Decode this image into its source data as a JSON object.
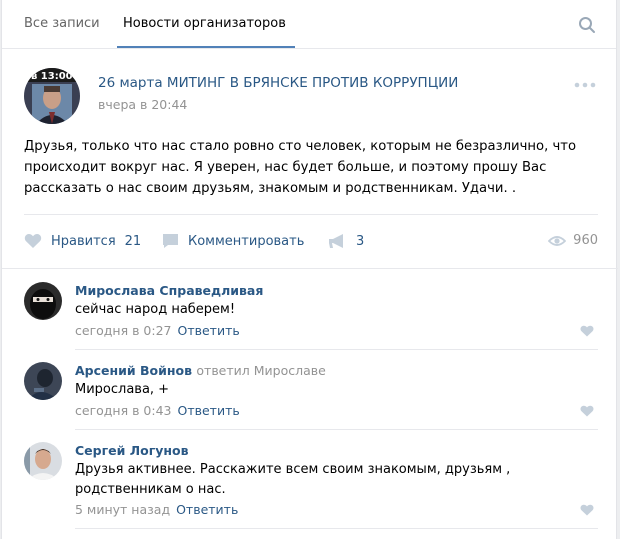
{
  "tabs": [
    {
      "label": "Все записи",
      "active": false
    },
    {
      "label": "Новости организаторов",
      "active": true
    }
  ],
  "post": {
    "avatar_caption": "в 13:00",
    "title": "26 марта МИТИНГ В БРЯНСКЕ ПРОТИВ КОРРУПЦИИ",
    "date": "вчера в 20:44",
    "text": "Друзья, только что нас стало ровно сто человек, которым не безразлично, что происходит вокруг нас. Я уверен, нас будет больше, и поэтому прошу Вас рассказать о нас своим друзьям, знакомым и родственникам. Удачи. .",
    "like_label": "Нравится",
    "like_count": "21",
    "comment_label": "Комментировать",
    "share_count": "3",
    "views": "960"
  },
  "comments": [
    {
      "author": "Мирослава Справедливая",
      "reply_to": "",
      "text": "сейчас народ наберем!",
      "time": "сегодня в 0:27",
      "reply_label": "Ответить"
    },
    {
      "author": "Арсений Войнов",
      "reply_to": "ответил Мирославе",
      "text": "Мирослава, +",
      "time": "сегодня в 0:43",
      "reply_label": "Ответить"
    },
    {
      "author": "Сергей Логунов",
      "reply_to": "",
      "text": "Друзья активнее. Расскажите всем своим знакомым, друзьям , родственникам о нас.",
      "time": "5 минут назад",
      "reply_label": "Ответить"
    }
  ],
  "colors": {
    "link": "#2a5885",
    "muted": "#939393",
    "accent": "#5181b8",
    "icon": "#c5d0db"
  }
}
